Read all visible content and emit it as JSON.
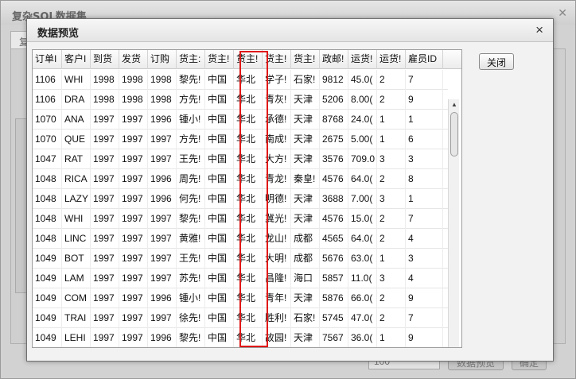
{
  "background_dialog": {
    "title": "复杂SQL数据集",
    "tab_label": "复",
    "bottom_text": "",
    "input_value": "100",
    "button1_label": "数据预览",
    "button2_label": "确定"
  },
  "dialog": {
    "title": "数据预览",
    "close_label": "关闭"
  },
  "table": {
    "columns": [
      "订单I",
      "客户I",
      "到货",
      "发货",
      "订购",
      "货主:",
      "货主!",
      "货主!",
      "货主!",
      "货主!",
      "政邮!",
      "运货!",
      "运货!",
      "雇员ID"
    ],
    "rows": [
      [
        "1106",
        "WHI",
        "1998",
        "1998",
        "1998",
        "黎先!",
        "中国",
        "华北",
        "学子!",
        "石家!",
        "9812",
        "45.0(",
        "2",
        "7"
      ],
      [
        "1106",
        "DRA",
        "1998",
        "1998",
        "1998",
        "方先!",
        "中国",
        "华北",
        "青灰!",
        "天津",
        "5206",
        "8.00(",
        "2",
        "9"
      ],
      [
        "1070",
        "ANA",
        "1997",
        "1997",
        "1996",
        "锺小!",
        "中国",
        "华北",
        "承德!",
        "天津",
        "8768",
        "24.0(",
        "1",
        "1"
      ],
      [
        "1070",
        "QUE",
        "1997",
        "1997",
        "1997",
        "方先!",
        "中国",
        "华北",
        "南成!",
        "天津",
        "2675",
        "5.00(",
        "1",
        "6"
      ],
      [
        "1047",
        "RAT",
        "1997",
        "1997",
        "1997",
        "王先!",
        "中国",
        "华北",
        "大方!",
        "天津",
        "3576",
        "709.0",
        "3",
        "3"
      ],
      [
        "1048",
        "RICA",
        "1997",
        "1997",
        "1996",
        "周先!",
        "中国",
        "华北",
        "青龙!",
        "秦皇!",
        "4576",
        "64.0(",
        "2",
        "8"
      ],
      [
        "1048",
        "LAZY",
        "1997",
        "1997",
        "1996",
        "何先!",
        "中国",
        "华北",
        "明德!",
        "天津",
        "3688",
        "7.00(",
        "3",
        "1"
      ],
      [
        "1048",
        "WHI",
        "1997",
        "1997",
        "1997",
        "黎先!",
        "中国",
        "华北",
        "冀光!",
        "天津",
        "4576",
        "15.0(",
        "2",
        "7"
      ],
      [
        "1048",
        "LINC",
        "1997",
        "1997",
        "1997",
        "黄雅!",
        "中国",
        "华北",
        "龙山!",
        "成都",
        "4565",
        "64.0(",
        "2",
        "4"
      ],
      [
        "1049",
        "BOT",
        "1997",
        "1997",
        "1997",
        "王先!",
        "中国",
        "华北",
        "大明!",
        "成都",
        "5676",
        "63.0(",
        "1",
        "3"
      ],
      [
        "1049",
        "LAM",
        "1997",
        "1997",
        "1997",
        "苏先!",
        "中国",
        "华北",
        "昌隆!",
        "海口",
        "5857",
        "11.0(",
        "3",
        "4"
      ],
      [
        "1049",
        "COM",
        "1997",
        "1997",
        "1996",
        "锺小!",
        "中国",
        "华北",
        "青年!",
        "天津",
        "5876",
        "66.0(",
        "2",
        "9"
      ],
      [
        "1049",
        "TRAI",
        "1997",
        "1997",
        "1997",
        "徐先!",
        "中国",
        "华北",
        "胜利!",
        "石家!",
        "5745",
        "47.0(",
        "2",
        "7"
      ],
      [
        "1049",
        "LEHI",
        "1997",
        "1997",
        "1996",
        "黎先!",
        "中国",
        "华北",
        "故园!",
        "天津",
        "7567",
        "36.0(",
        "1",
        "9"
      ]
    ]
  },
  "scrollbar": {
    "up_icon": "triangle-up",
    "down_icon": "triangle-down"
  },
  "colors": {
    "highlight": "#e01818"
  }
}
